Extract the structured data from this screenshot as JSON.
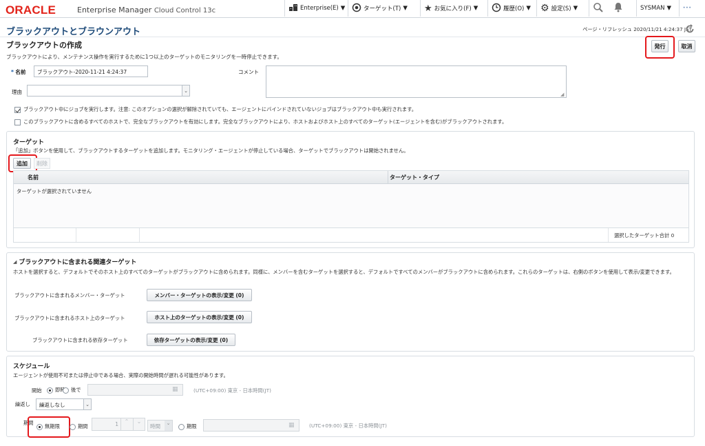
{
  "header": {
    "brand": "ORACLE",
    "product": "Enterprise Manager",
    "product_suffix": "Cloud Control 13c",
    "nav": [
      {
        "label": "Enterprise(E)",
        "icon": "enterprise-icon"
      },
      {
        "label": "ターゲット(T)",
        "icon": "target-icon"
      },
      {
        "label": "お気に入り(F)",
        "icon": "star-icon"
      },
      {
        "label": "履歴(O)",
        "icon": "clock-icon"
      },
      {
        "label": "設定(S)",
        "icon": "gear-icon"
      }
    ],
    "user": "SYSMAN",
    "user_caret": "▼",
    "caret": "▼"
  },
  "page": {
    "title": "ブラックアウトとブラウンアウト",
    "refresh": "ページ・リフレッシュ 2020/11/21 4:24:37 JST",
    "subtitle": "ブラックアウトの作成",
    "description": "ブラックアウトにより、メンテナンス操作を実行するために1つ以上のターゲットのモニタリングを一時停止できます。",
    "submit_label": "発行",
    "cancel_label": "取消"
  },
  "form": {
    "name_required": "*",
    "name_label": "名前",
    "name_value": "ブラックアウト-2020-11-21 4:24:37",
    "comment_label": "コメント",
    "comment_value": "",
    "reason_label": "理由",
    "reason_value": "",
    "option1_checked": true,
    "option1": "ブラックアウト中にジョブを実行します。注意: このオプションの選択が解除されていても、エージェントにバインドされていないジョブはブラックアウト中も実行されます。",
    "option2_checked": false,
    "option2": "このブラックアウトに含めるすべてのホストで、完全なブラックアウトを有効にします。完全なブラックアウトにより、ホストおよびホスト上のすべてのターゲット(エージェントを含む)がブラックアウトされます。"
  },
  "targets": {
    "title": "ターゲット",
    "hint": "「追加」ボタンを使用して、ブラックアウトするターゲットを追加します。モニタリング・エージェントが停止している場合、ターゲットでブラックアウトは開始されません。",
    "add_label": "追加",
    "remove_label": "削除",
    "columns": [
      "名前",
      "ターゲット・タイプ"
    ],
    "empty_text": "ターゲットが選択されていません",
    "total_text": "選択したターゲット合計 0"
  },
  "related": {
    "title": "ブラックアウトに含まれる関連ターゲット",
    "description": "ホストを選択すると、デフォルトでそのホスト上のすべてのターゲットがブラックアウトに含められます。同様に、メンバーを含むターゲットを選択すると、デフォルトですべてのメンバーがブラックアウトに含められます。これらのターゲットは、右側のボタンを使用して表示/変更できます。",
    "rows": [
      {
        "label": "ブラックアウトに含まれるメンバー・ターゲット",
        "button": "メンバー・ターゲットの表示/変更 (0)"
      },
      {
        "label": "ブラックアウトに含まれるホスト上のターゲット",
        "button": "ホスト上のターゲットの表示/変更 (0)"
      },
      {
        "label": "ブラックアウトに含まれる依存ターゲット",
        "button": "依存ターゲットの表示/変更 (0)"
      }
    ]
  },
  "schedule": {
    "title": "スケジュール",
    "description": "エージェントが使用不可または停止中である場合、実際の開始時間が遅れる可能性があります。",
    "start_label": "開始",
    "start_now": "即時",
    "start_later": "後で",
    "timezone": "(UTC+09:00) 東京 - 日本時間(JT)",
    "repeat_label": "繰返し",
    "repeat_value": "繰返しなし",
    "duration_label": "期間",
    "indefinite": "無期限",
    "period": "期間",
    "period_value": "1",
    "period_unit": "時間",
    "until": "期限",
    "timezone2": "(UTC+09:00) 東京 - 日本時間(JT)"
  }
}
